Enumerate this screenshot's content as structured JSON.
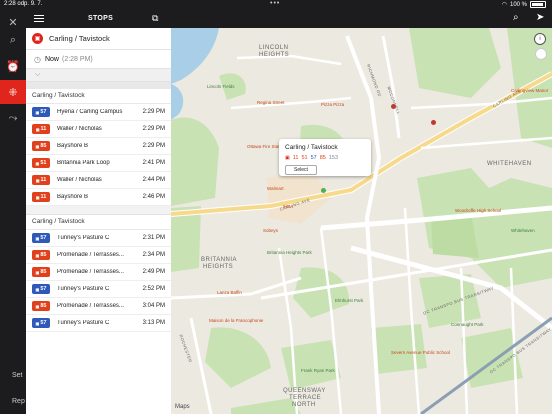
{
  "status_bar": {
    "time": "2:28",
    "date": "odp. 9. 7.",
    "battery": "100 %"
  },
  "rail": {
    "settings_label": "Set",
    "report_label": "Rep"
  },
  "header": {
    "title": "STOPS"
  },
  "stop": {
    "name": "Carling / Tavistock",
    "when_label": "Now",
    "when_time": "(2:28 PM)"
  },
  "sections": [
    {
      "title": "Carling / Tavistock",
      "rows": [
        {
          "route": "57",
          "color": "blue",
          "dest": "Hyena / Carling Campus",
          "time": "2:29 PM"
        },
        {
          "route": "11",
          "color": "red",
          "dest": "Waller / Nicholas",
          "time": "2:29 PM"
        },
        {
          "route": "85",
          "color": "red",
          "dest": "Bayshore B",
          "time": "2:29 PM"
        },
        {
          "route": "51",
          "color": "red",
          "dest": "Britannia Park Loop",
          "time": "2:41 PM"
        },
        {
          "route": "11",
          "color": "red",
          "dest": "Waller / Nicholas",
          "time": "2:44 PM"
        },
        {
          "route": "11",
          "color": "red",
          "dest": "Bayshore B",
          "time": "2:46 PM"
        }
      ]
    },
    {
      "title": "Carling / Tavistock",
      "rows": [
        {
          "route": "57",
          "color": "blue",
          "dest": "Tunney's Pasture C",
          "time": "2:31 PM"
        },
        {
          "route": "85",
          "color": "red",
          "dest": "Promenade / Terrasses...",
          "time": "2:34 PM"
        },
        {
          "route": "85",
          "color": "red",
          "dest": "Promenade / Terrasses...",
          "time": "2:49 PM"
        },
        {
          "route": "57",
          "color": "blue",
          "dest": "Tunney's Pasture C",
          "time": "2:52 PM"
        },
        {
          "route": "85",
          "color": "red",
          "dest": "Promenade / Terrasses...",
          "time": "3:04 PM"
        },
        {
          "route": "57",
          "color": "blue",
          "dest": "Tunney's Pasture C",
          "time": "3:13 PM"
        }
      ]
    }
  ],
  "callout": {
    "title": "Carling / Tavistock",
    "routes": [
      {
        "num": "11",
        "color": "#e0401c"
      },
      {
        "num": "51",
        "color": "#e0401c"
      },
      {
        "num": "57",
        "color": "#2e59b9"
      },
      {
        "num": "85",
        "color": "#e0401c"
      },
      {
        "num": "153",
        "color": "#7a8a9a"
      }
    ],
    "select_label": "Select"
  },
  "map": {
    "attribution": "Maps",
    "labels": [
      "LINCOLN",
      "HEIGHTS",
      "WHITEHAVEN",
      "BRITANNIA",
      "HEIGHTS",
      "QUEENSWAY",
      "TERRACE",
      "NORTH",
      "CARLING AVE",
      "CARLING AVE",
      "OC TRANSPO BUS TRANSITWAY",
      "OC TRANSPO BUS TRANSITWAY",
      "RICHMOND RD",
      "MCCONNELL",
      "ROCHESTER",
      "Lincoln Fields",
      "Regina Street",
      "Ottawa Fire Station 31",
      "Pizza Pizza",
      "Carlingview Manor",
      "Walmart",
      "IKEA",
      "Sobeys",
      "Woodroffe High School",
      "Whitehaven",
      "Connaught Park",
      "Frank Ryan Park",
      "Severn Avenue Public School",
      "Elmhurst Park",
      "Britannia Heights Park",
      "Lanza Baffin",
      "Maison de la Francophonie"
    ]
  }
}
